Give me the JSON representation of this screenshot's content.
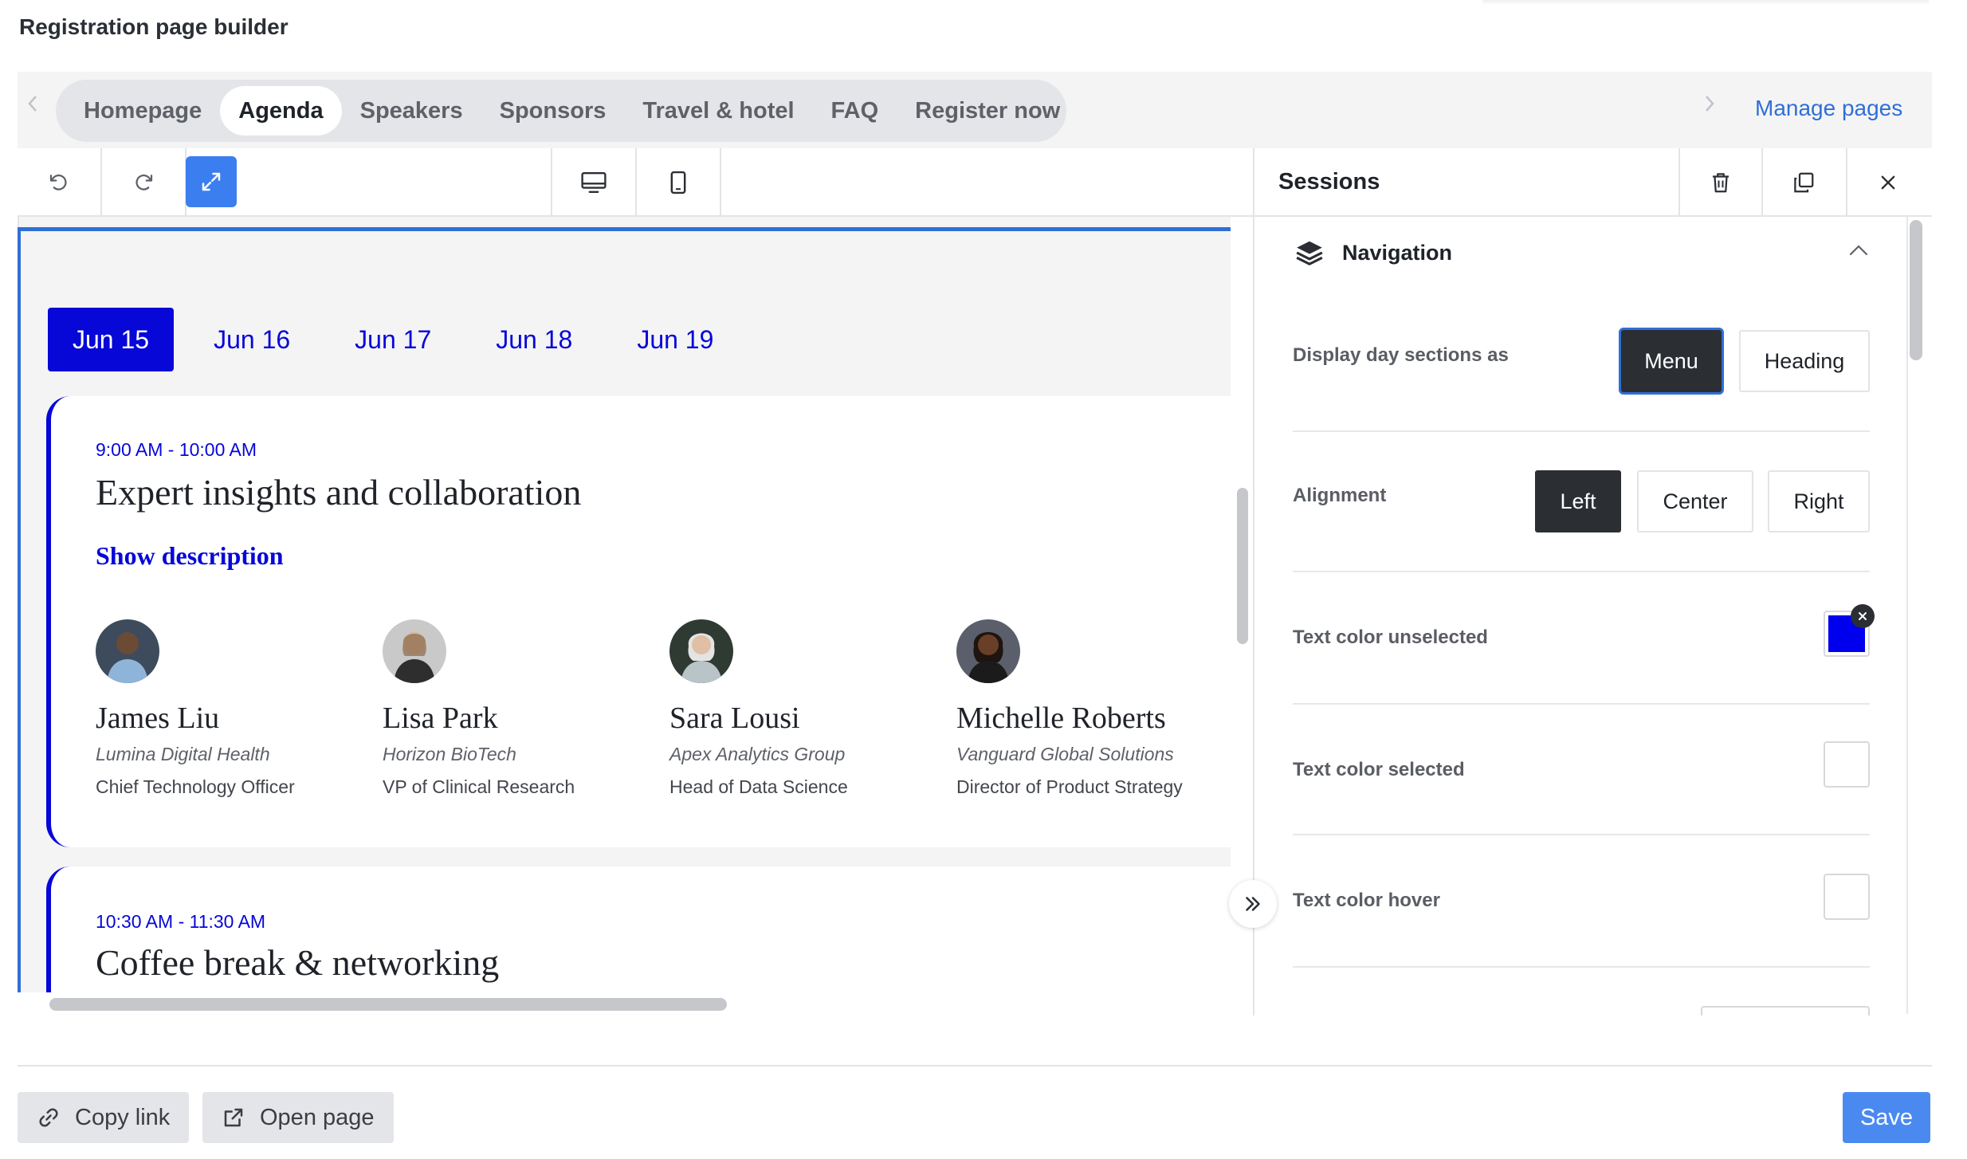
{
  "app": {
    "title": "Registration page builder"
  },
  "pages": {
    "tabs": [
      {
        "label": "Homepage",
        "active": false
      },
      {
        "label": "Agenda",
        "active": true
      },
      {
        "label": "Speakers",
        "active": false
      },
      {
        "label": "Sponsors",
        "active": false
      },
      {
        "label": "Travel & hotel",
        "active": false
      },
      {
        "label": "FAQ",
        "active": false
      },
      {
        "label": "Register now",
        "active": false
      }
    ],
    "manage_label": "Manage pages"
  },
  "toolbar": {
    "icons": [
      "undo-icon",
      "redo-icon",
      "expand-icon",
      "desktop-icon",
      "mobile-icon"
    ]
  },
  "canvas": {
    "days": [
      {
        "label": "Jun 15",
        "active": true
      },
      {
        "label": "Jun 16",
        "active": false
      },
      {
        "label": "Jun 17",
        "active": false
      },
      {
        "label": "Jun 18",
        "active": false
      },
      {
        "label": "Jun 19",
        "active": false
      }
    ],
    "sessions": [
      {
        "time": "9:00 AM - 10:00 AM",
        "title": "Expert insights and collaboration",
        "show_description": "Show description",
        "speakers": [
          {
            "name": "James Liu",
            "company": "Lumina Digital Health",
            "role": "Chief Technology Officer"
          },
          {
            "name": "Lisa Park",
            "company": "Horizon BioTech",
            "role": "VP of Clinical Research"
          },
          {
            "name": "Sara Lousi",
            "company": "Apex Analytics Group",
            "role": "Head of Data Science"
          },
          {
            "name": "Michelle Roberts",
            "company": "Vanguard Global Solutions",
            "role": "Director of Product Strategy"
          }
        ]
      },
      {
        "time": "10:30 AM - 11:30 AM",
        "title": "Coffee break & networking"
      }
    ],
    "accent_color": "#0707d8"
  },
  "panel": {
    "title": "Sessions",
    "section": {
      "title": "Navigation",
      "icon": "layers-icon"
    },
    "display_day": {
      "label": "Display day sections as",
      "options": [
        "Menu",
        "Heading"
      ],
      "selected": "Menu"
    },
    "alignment": {
      "label": "Alignment",
      "options": [
        "Left",
        "Center",
        "Right"
      ],
      "selected": "Left"
    },
    "text_color_unselected": {
      "label": "Text color unselected",
      "value": "#0000ee"
    },
    "text_color_selected": {
      "label": "Text color selected",
      "value": "#ffffff"
    },
    "text_color_hover": {
      "label": "Text color hover",
      "value": "#ffffff"
    }
  },
  "footer": {
    "copy_link": "Copy link",
    "open_page": "Open page",
    "save": "Save"
  }
}
